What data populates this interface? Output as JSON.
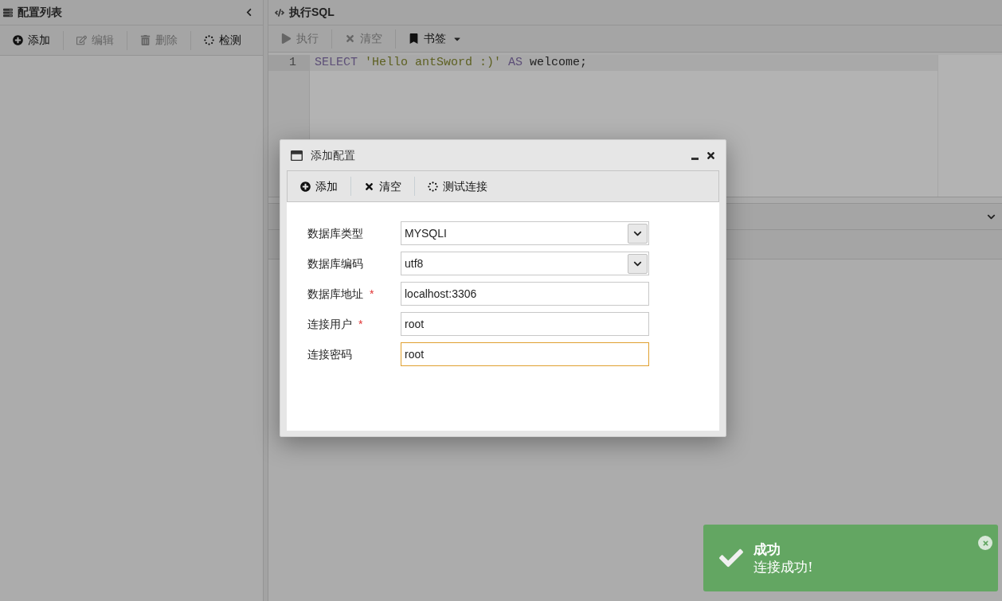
{
  "left_panel": {
    "title": "配置列表",
    "toolbar": [
      {
        "label": "添加",
        "disabled": false
      },
      {
        "label": "编辑",
        "disabled": true
      },
      {
        "label": "删除",
        "disabled": true
      },
      {
        "label": "检测",
        "disabled": false
      }
    ]
  },
  "sql_panel": {
    "title": "执行SQL",
    "toolbar": [
      {
        "label": "执行",
        "disabled": true
      },
      {
        "label": "清空",
        "disabled": true
      },
      {
        "label": "书签",
        "disabled": false
      }
    ],
    "lines": [
      {
        "number": "1",
        "tokens": [
          {
            "kind": "keyword",
            "text": "SELECT"
          },
          {
            "kind": "string",
            "text": "'Hello antSword :)'"
          },
          {
            "kind": "keyword",
            "text": "AS"
          },
          {
            "kind": "plain",
            "text": "welcome;"
          }
        ]
      }
    ]
  },
  "dialog": {
    "title": "添加配置",
    "toolbar": [
      {
        "label": "添加"
      },
      {
        "label": "清空"
      },
      {
        "label": "测试连接"
      }
    ],
    "fields": [
      {
        "label": "数据库类型",
        "kind": "select",
        "value": "MYSQLI",
        "focused": false
      },
      {
        "label": "数据库编码",
        "kind": "select",
        "value": "utf8",
        "focused": false
      },
      {
        "label": "数据库地址",
        "required_mark": "*",
        "kind": "text",
        "value": "localhost:3306",
        "focused": false
      },
      {
        "label": "连接用户",
        "required_mark": "*",
        "kind": "text",
        "value": "root",
        "focused": false
      },
      {
        "label": "连接密码",
        "kind": "text",
        "value": "root",
        "focused": true
      }
    ]
  },
  "toast": {
    "title": "成功",
    "message": "连接成功!"
  }
}
